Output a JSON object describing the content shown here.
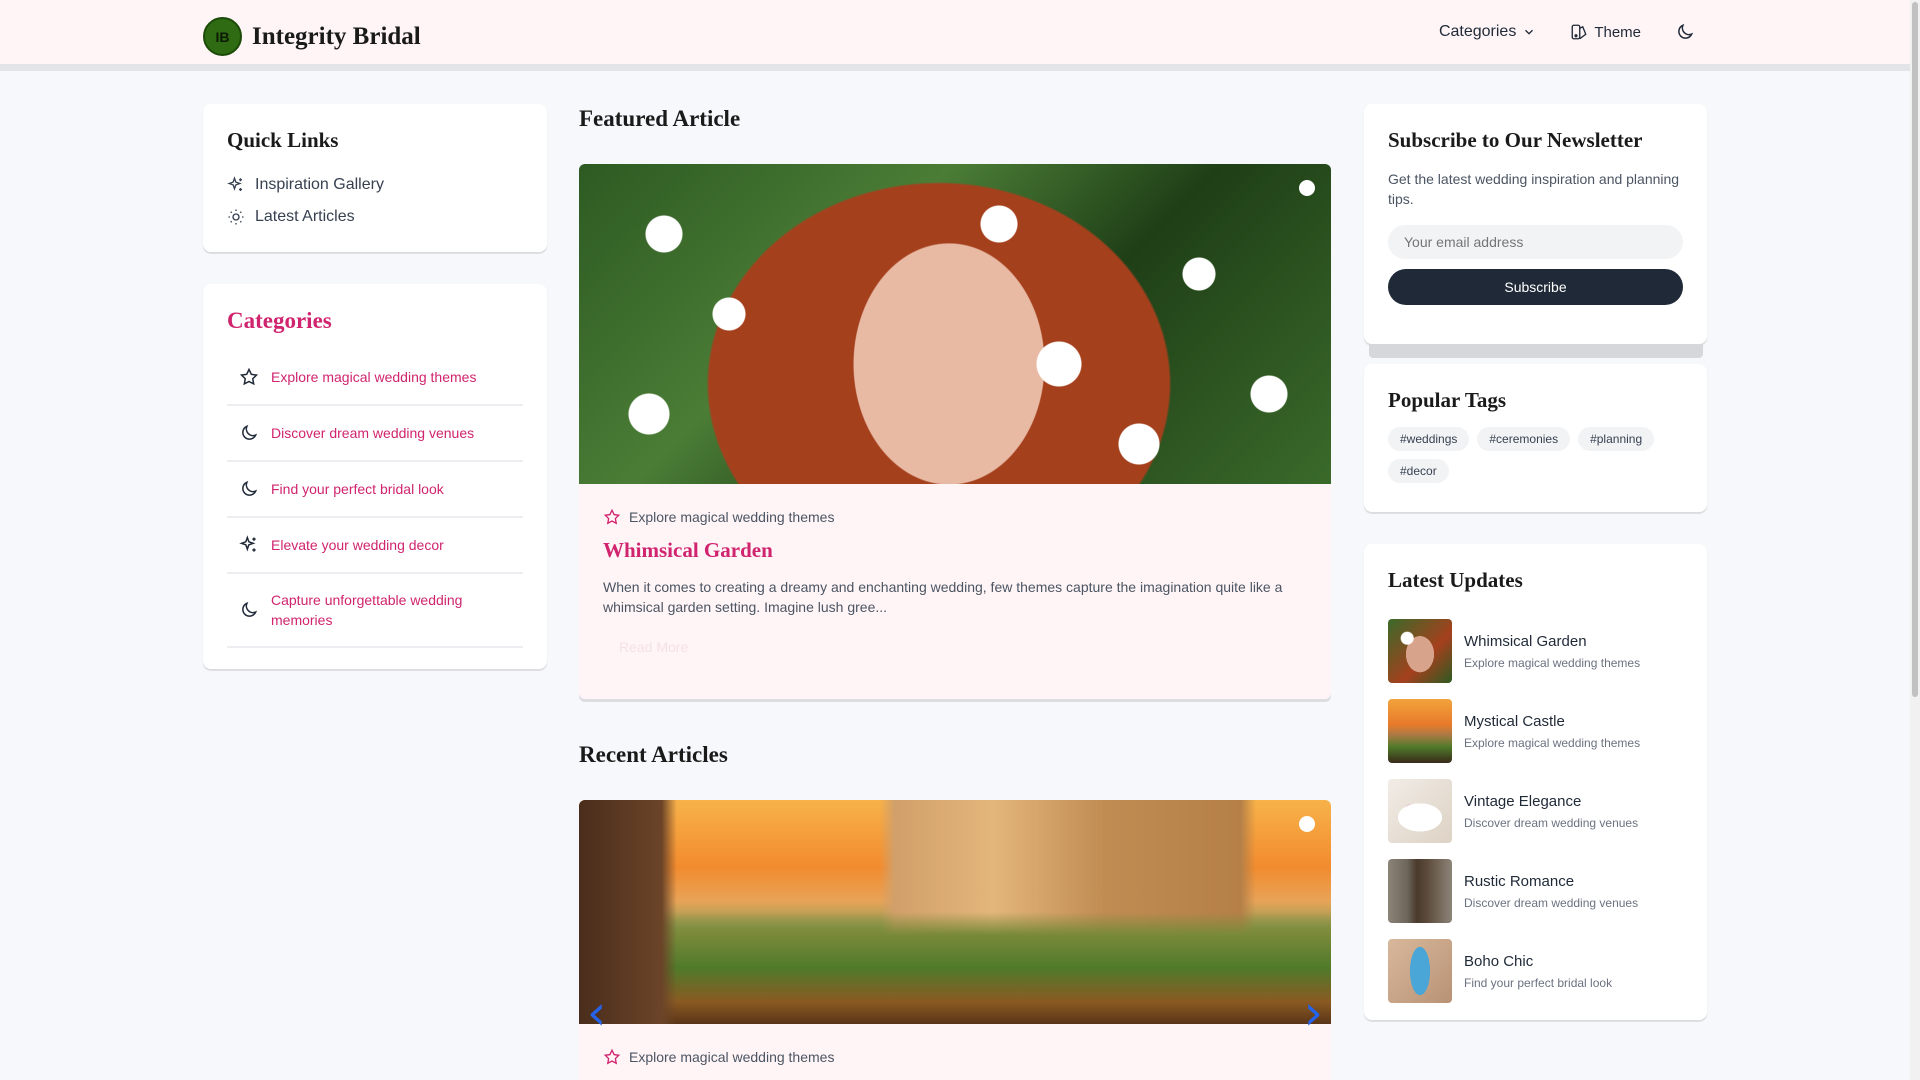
{
  "header": {
    "logo_initials": "IB",
    "brand_name": "Integrity Bridal",
    "nav": {
      "categories_label": "Categories",
      "theme_label": "Theme"
    }
  },
  "quick_links": {
    "title": "Quick Links",
    "items": [
      {
        "label": "Inspiration Gallery",
        "icon": "sparkles-icon"
      },
      {
        "label": "Latest Articles",
        "icon": "sun-icon"
      }
    ]
  },
  "categories": {
    "title": "Categories",
    "items": [
      {
        "label": "Explore magical wedding themes",
        "icon": "star-icon"
      },
      {
        "label": "Discover dream wedding venues",
        "icon": "moon-icon"
      },
      {
        "label": "Find your perfect bridal look",
        "icon": "moon-icon"
      },
      {
        "label": "Elevate your wedding decor",
        "icon": "sparkles-icon"
      },
      {
        "label": "Capture unforgettable wedding memories",
        "icon": "moon-icon"
      }
    ]
  },
  "featured": {
    "section_title": "Featured Article",
    "category": "Explore magical wedding themes",
    "title": "Whimsical Garden",
    "excerpt": "When it comes to creating a dreamy and enchanting wedding, few themes capture the imagination quite like a whimsical garden setting. Imagine lush gree...",
    "read_more": "Read More"
  },
  "recent": {
    "section_title": "Recent Articles",
    "category": "Explore magical wedding themes",
    "prev_arrow": "‹",
    "next_arrow": "›"
  },
  "newsletter": {
    "title": "Subscribe to Our Newsletter",
    "description": "Get the latest wedding inspiration and planning tips.",
    "placeholder": "Your email address",
    "button": "Subscribe"
  },
  "tags": {
    "title": "Popular Tags",
    "items": [
      "#weddings",
      "#ceremonies",
      "#planning",
      "#decor"
    ]
  },
  "updates": {
    "title": "Latest Updates",
    "items": [
      {
        "title": "Whimsical Garden",
        "category": "Explore magical wedding themes"
      },
      {
        "title": "Mystical Castle",
        "category": "Explore magical wedding themes"
      },
      {
        "title": "Vintage Elegance",
        "category": "Discover dream wedding venues"
      },
      {
        "title": "Rustic Romance",
        "category": "Discover dream wedding venues"
      },
      {
        "title": "Boho Chic",
        "category": "Find your perfect bridal look"
      }
    ]
  },
  "colors": {
    "accent_pink": "#d0246e",
    "header_bg": "#fff5f7",
    "button_dark": "#1f2937",
    "logo_green": "#2e6b12"
  }
}
